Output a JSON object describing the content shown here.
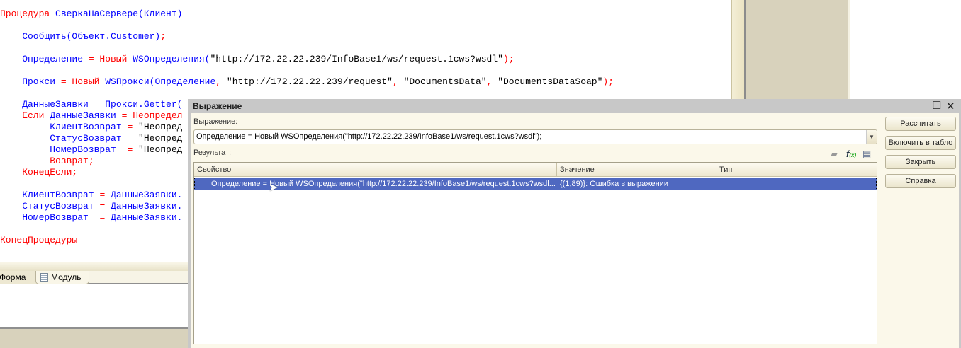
{
  "editor": {
    "lines": [
      [
        [
          "Процедура ",
          "kw"
        ],
        [
          "СверкаНаСервере(Клиент)",
          "id"
        ]
      ],
      [],
      [
        [
          "    Сообщить(Объект.Customer)",
          "id"
        ],
        [
          ";",
          "kw"
        ]
      ],
      [],
      [
        [
          "    Определение ",
          "id"
        ],
        [
          "= Новый ",
          "kw"
        ],
        [
          "WSОпределения(",
          "id"
        ],
        [
          "\"http://172.22.22.239/InfoBase1/ws/request.1cws?wsdl\"",
          "st"
        ],
        [
          ");",
          "kw"
        ]
      ],
      [],
      [
        [
          "    Прокси ",
          "id"
        ],
        [
          "= Новый ",
          "kw"
        ],
        [
          "WSПрокси(Определение",
          "id"
        ],
        [
          ", ",
          "kw"
        ],
        [
          "\"http://172.22.22.239/request\"",
          "st"
        ],
        [
          ", ",
          "kw"
        ],
        [
          "\"DocumentsData\"",
          "st"
        ],
        [
          ", ",
          "kw"
        ],
        [
          "\"DocumentsDataSoap\"",
          "st"
        ],
        [
          ");",
          "kw"
        ]
      ],
      [],
      [
        [
          "    ДанныеЗаявки ",
          "id"
        ],
        [
          "= ",
          "kw"
        ],
        [
          "Прокси.Getter(",
          "id"
        ]
      ],
      [
        [
          "    Если ",
          "kw"
        ],
        [
          "ДанныеЗаявки ",
          "id"
        ],
        [
          "= Неопредел",
          "kw"
        ]
      ],
      [
        [
          "         КлиентВозврат ",
          "id"
        ],
        [
          "= ",
          "kw"
        ],
        [
          "\"Неопред",
          "st"
        ]
      ],
      [
        [
          "         СтатусВозврат ",
          "id"
        ],
        [
          "= ",
          "kw"
        ],
        [
          "\"Неопред",
          "st"
        ]
      ],
      [
        [
          "         НомерВозврат  ",
          "id"
        ],
        [
          "= ",
          "kw"
        ],
        [
          "\"Неопред",
          "st"
        ]
      ],
      [
        [
          "         Возврат;",
          "kw"
        ]
      ],
      [
        [
          "    КонецЕсли;",
          "kw"
        ]
      ],
      [],
      [
        [
          "    КлиентВозврат ",
          "id"
        ],
        [
          "= ",
          "kw"
        ],
        [
          "ДанныеЗаявки.",
          "id"
        ]
      ],
      [
        [
          "    СтатусВозврат ",
          "id"
        ],
        [
          "= ",
          "kw"
        ],
        [
          "ДанныеЗаявки.",
          "id"
        ]
      ],
      [
        [
          "    НомерВозврат  ",
          "id"
        ],
        [
          "= ",
          "kw"
        ],
        [
          "ДанныеЗаявки.",
          "id"
        ]
      ],
      [],
      [
        [
          "КонецПроцедуры",
          "kw"
        ]
      ]
    ]
  },
  "tabs": {
    "form": "Форма",
    "module": "Модуль"
  },
  "dialog": {
    "title": "Выражение",
    "expression_label": "Выражение:",
    "expression_value": "Определение = Новый WSОпределения(\"http://172.22.22.239/InfoBase1/ws/request.1cws?wsdl\");",
    "result_label": "Результат:",
    "columns": [
      "Свойство",
      "Значение",
      "Тип"
    ],
    "row": {
      "property": "Определение = Новый WSОпределения(\"http://172.22.22.239/InfoBase1/ws/request.1cws?wsdl...",
      "value": "{(1,89)}: Ошибка в выражении",
      "type": ""
    },
    "buttons": {
      "calculate": "Рассчитать",
      "add_to_board": "Включить в табло",
      "close": "Закрыть",
      "help": "Справка"
    }
  }
}
